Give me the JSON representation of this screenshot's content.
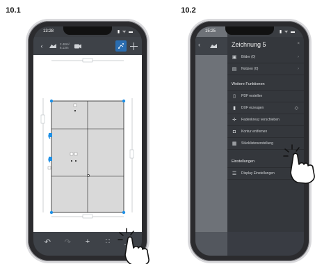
{
  "steps": {
    "left": "10.1",
    "right": "10.2"
  },
  "phone1": {
    "status_time": "13:28",
    "status_icons": "▮ ᯤ ▬",
    "toolbar": {
      "back_icon": "chevron-left-icon",
      "area_info_line1": "2.48m²",
      "area_info_line2": "6.13m",
      "camera_icon": "camera-icon"
    },
    "bottom": {
      "undo": "↶",
      "redo": "↷",
      "add": "+",
      "fit": "⛶",
      "more": "⋰"
    }
  },
  "phone2": {
    "status_time": "15:25",
    "status_icons": "▮ ᯤ ▬",
    "menu": {
      "title": "Zeichnung 5",
      "close": "×",
      "items_top": [
        {
          "icon": "▣",
          "label": "Bilder (0)"
        },
        {
          "icon": "▤",
          "label": "Notizen (0)"
        }
      ],
      "section_more": "Weitere Funktionen",
      "items_more": [
        {
          "icon": "▯",
          "label": "PDF erstellen"
        },
        {
          "icon": "▮",
          "label": "DXF erzeugen"
        },
        {
          "icon": "✛",
          "label": "Fadenkreuz verschieben"
        },
        {
          "icon": "◘",
          "label": "Kontur entfernen"
        },
        {
          "icon": "▦",
          "label": "Stücklistenerstellung"
        }
      ],
      "section_settings": "Einstellungen",
      "items_settings": [
        {
          "icon": "☰",
          "label": "Display Einstellungen"
        }
      ]
    }
  },
  "colors": {
    "accent_blue": "#1e90e6",
    "panel": "#d6d6d6"
  }
}
